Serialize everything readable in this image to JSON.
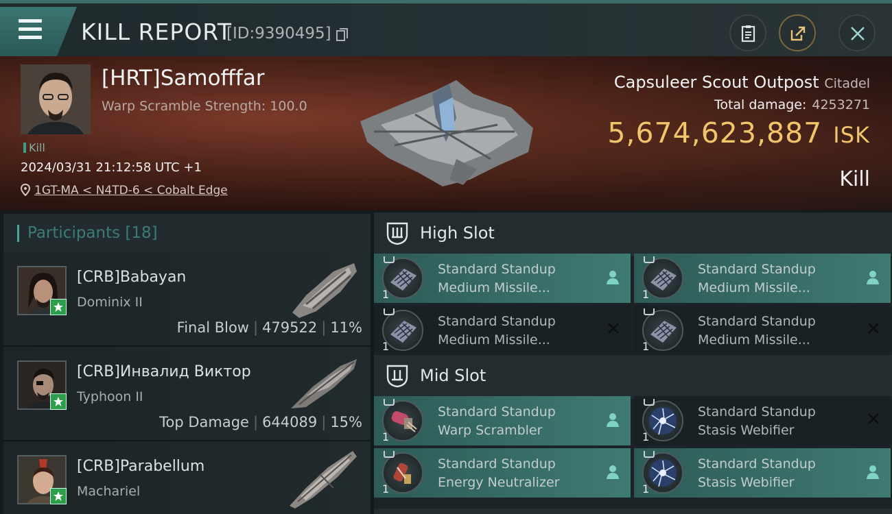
{
  "header": {
    "title": "KILL REPORT",
    "report_id": "[ID:9390495]",
    "icons": [
      "clipboard-icon",
      "share-icon",
      "close-icon"
    ]
  },
  "victim": {
    "name": "[HRT]Samofffar",
    "warp_scramble": "Warp Scramble Strength: 100.0",
    "kill_tag": "Kill",
    "timestamp": "2024/03/31 21:12:58 UTC +1",
    "location": "1GT-MA < N4TD-6 < Cobalt Edge",
    "ship_name": "Capsuleer Scout Outpost",
    "ship_class": "Citadel",
    "total_damage_label": "Total damage:",
    "total_damage": "4253271",
    "isk_value": "5,674,623,887",
    "isk_unit": "ISK",
    "result": "Kill"
  },
  "participants": {
    "label": "Participants [18]",
    "rows": [
      {
        "name": "[CRB]Babayan",
        "ship": "Dominix II",
        "role": "Final Blow",
        "damage": "479522",
        "percent": "11%"
      },
      {
        "name": "[CRB]Инвалид Виктор",
        "ship": "Typhoon II",
        "role": "Top Damage",
        "damage": "644089",
        "percent": "15%"
      },
      {
        "name": "[CRB]Parabellum",
        "ship": "Machariel",
        "role": "",
        "damage": "",
        "percent": ""
      }
    ]
  },
  "fittings": {
    "high_slot_label": "High Slot",
    "mid_slot_label": "Mid Slot",
    "high": [
      {
        "line1": "Standard Standup",
        "line2": "Medium Missile...",
        "count": "1",
        "state": "dropped"
      },
      {
        "line1": "Standard Standup",
        "line2": "Medium Missile...",
        "count": "1",
        "state": "dropped"
      },
      {
        "line1": "Standard Standup",
        "line2": "Medium Missile...",
        "count": "1",
        "state": "destroyed"
      },
      {
        "line1": "Standard Standup",
        "line2": "Medium Missile...",
        "count": "1",
        "state": "destroyed"
      }
    ],
    "mid": [
      {
        "line1": "Standard Standup",
        "line2": "Warp Scrambler",
        "count": "1",
        "state": "dropped"
      },
      {
        "line1": "Standard Standup",
        "line2": "Stasis Webifier",
        "count": "1",
        "state": "destroyed"
      },
      {
        "line1": "Standard Standup",
        "line2": "Energy Neutralizer",
        "count": "1",
        "state": "dropped"
      },
      {
        "line1": "Standard Standup",
        "line2": "Stasis Webifier",
        "count": "1",
        "state": "dropped"
      }
    ]
  },
  "colors": {
    "accent_teal": "#3f7a73",
    "isk_gold": "#f1c56a",
    "panel_dark": "#1b2326"
  }
}
